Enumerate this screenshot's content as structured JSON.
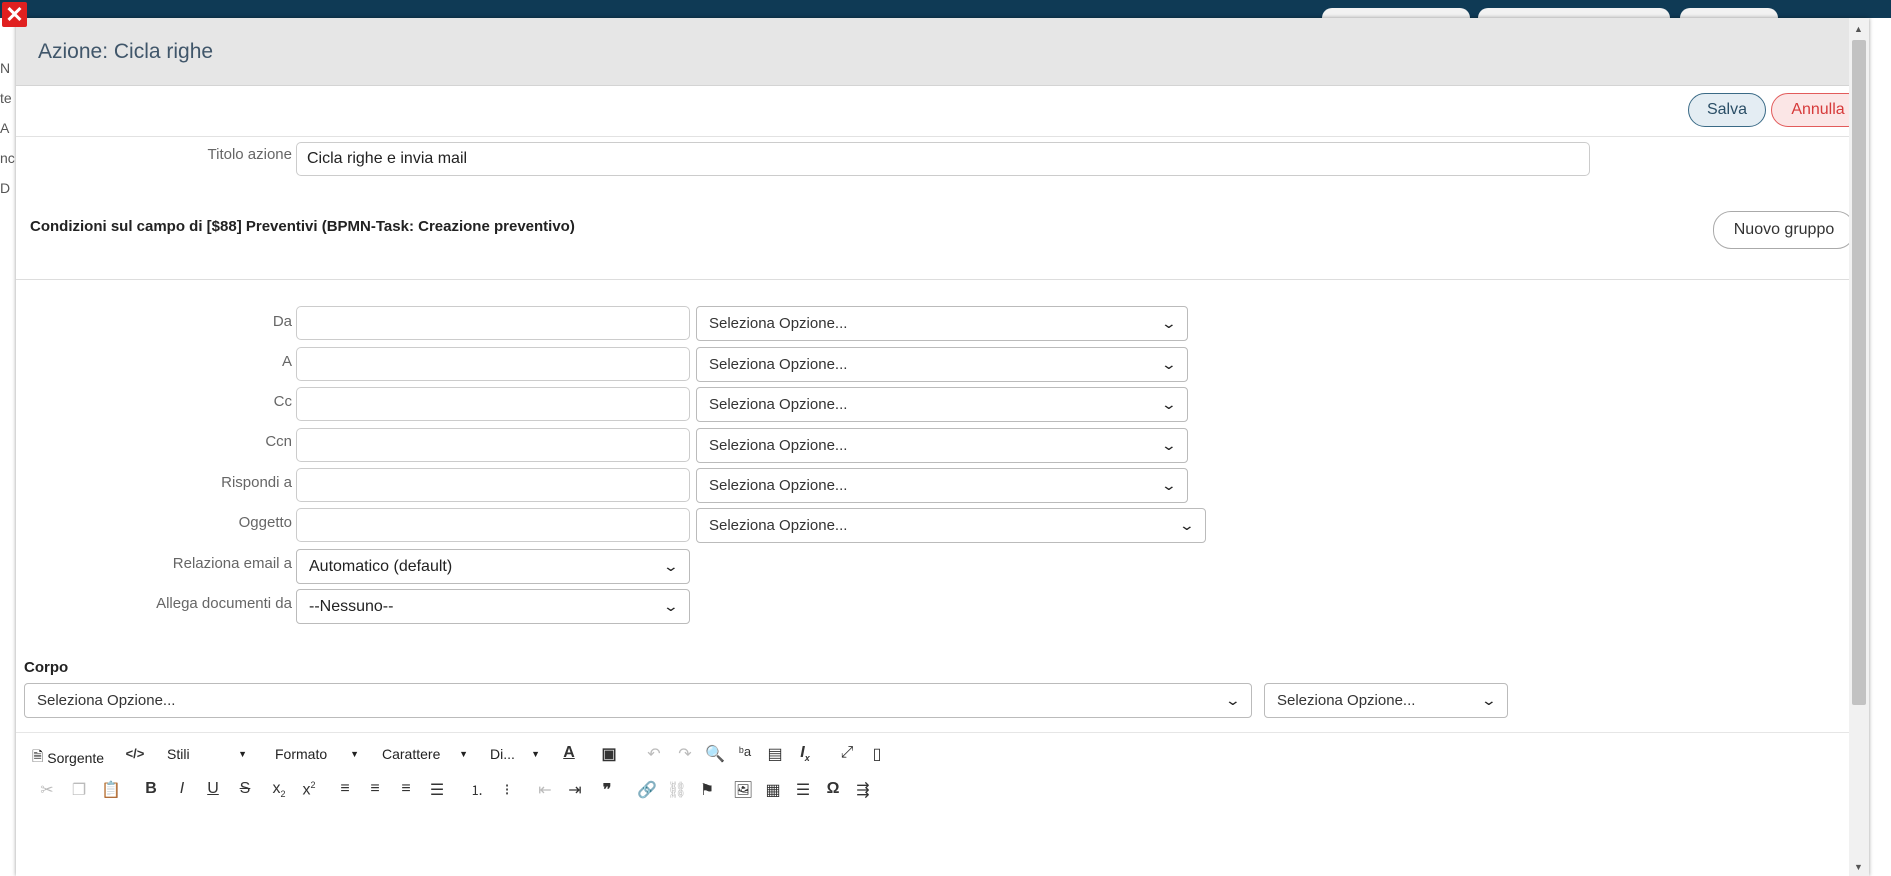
{
  "modal": {
    "title": "Azione: Cicla righe",
    "close_icon": "close-icon",
    "save_label": "Salva",
    "cancel_label": "Annulla"
  },
  "background": {
    "labels": [
      "N",
      "te",
      "A",
      "nc",
      "D"
    ]
  },
  "form": {
    "title_label": "Titolo azione",
    "title_value": "Cicla righe e invia mail",
    "conditions_title": "Condizioni sul campo di [$88] Preventivi (BPMN-Task: Creazione preventivo)",
    "new_group_label": "Nuovo gruppo",
    "rows": [
      {
        "label": "Da",
        "value": "",
        "option": "Seleziona Opzione..."
      },
      {
        "label": "A",
        "value": "",
        "option": "Seleziona Opzione..."
      },
      {
        "label": "Cc",
        "value": "",
        "option": "Seleziona Opzione..."
      },
      {
        "label": "Ccn",
        "value": "",
        "option": "Seleziona Opzione..."
      },
      {
        "label": "Rispondi a",
        "value": "",
        "option": "Seleziona Opzione..."
      },
      {
        "label": "Oggetto",
        "value": "",
        "option": "Seleziona Opzione..."
      }
    ],
    "relate_label": "Relaziona email a",
    "relate_value": "Automatico (default)",
    "attach_label": "Allega documenti da",
    "attach_value": "--Nessuno--",
    "body_label": "Corpo",
    "body_select_1": "Seleziona Opzione...",
    "body_select_2": "Seleziona Opzione..."
  },
  "editor": {
    "source_label": "Sorgente",
    "styles_label": "Stili",
    "format_label": "Formato",
    "font_label": "Carattere",
    "size_label": "Di..."
  }
}
